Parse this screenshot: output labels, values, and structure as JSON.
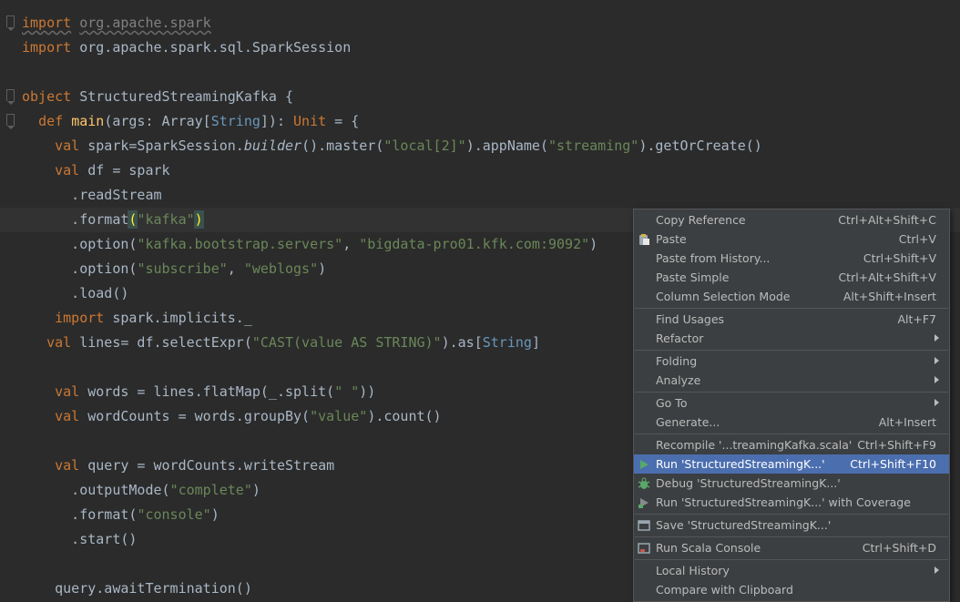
{
  "editor": {
    "lines": [
      {
        "parts": [
          {
            "t": "import",
            "c": "kw und"
          },
          {
            "t": " "
          },
          {
            "t": "org.apache.spark",
            "c": "gray und"
          }
        ]
      },
      {
        "parts": [
          {
            "t": "import",
            "c": "kw"
          },
          {
            "t": " org.apache.spark.sql.SparkSession"
          }
        ]
      },
      {
        "parts": []
      },
      {
        "parts": [
          {
            "t": "object",
            "c": "kw"
          },
          {
            "t": " StructuredStreamingKafka {"
          }
        ]
      },
      {
        "parts": [
          {
            "t": "  "
          },
          {
            "t": "def",
            "c": "kw"
          },
          {
            "t": " "
          },
          {
            "t": "main",
            "c": "fn"
          },
          {
            "t": "(args: Array["
          },
          {
            "t": "String",
            "c": "ty"
          },
          {
            "t": "]): "
          },
          {
            "t": "Unit",
            "c": "kw"
          },
          {
            "t": " = {"
          }
        ]
      },
      {
        "parts": [
          {
            "t": "    "
          },
          {
            "t": "val",
            "c": "kw"
          },
          {
            "t": " spark=SparkSession."
          },
          {
            "t": "builder",
            "c": "it"
          },
          {
            "t": "().master("
          },
          {
            "t": "\"local[2]\"",
            "c": "str"
          },
          {
            "t": ").appName("
          },
          {
            "t": "\"streaming\"",
            "c": "str"
          },
          {
            "t": ").getOrCreate()"
          }
        ]
      },
      {
        "parts": [
          {
            "t": "    "
          },
          {
            "t": "val",
            "c": "kw"
          },
          {
            "t": " df = spark"
          }
        ]
      },
      {
        "parts": [
          {
            "t": "      .readStream"
          }
        ]
      },
      {
        "parts": [
          {
            "t": "      .format"
          },
          {
            "t": "(",
            "c": "brace y"
          },
          {
            "t": "\"kafka\"",
            "c": "str"
          },
          {
            "t": ")",
            "c": "brace y"
          }
        ],
        "hl": true
      },
      {
        "parts": [
          {
            "t": "      .option("
          },
          {
            "t": "\"kafka.bootstrap.servers\"",
            "c": "str"
          },
          {
            "t": ", "
          },
          {
            "t": "\"bigdata-pro01.kfk.com:9092\"",
            "c": "str"
          },
          {
            "t": ")"
          }
        ]
      },
      {
        "parts": [
          {
            "t": "      .option("
          },
          {
            "t": "\"subscribe\"",
            "c": "str"
          },
          {
            "t": ", "
          },
          {
            "t": "\"weblogs\"",
            "c": "str"
          },
          {
            "t": ")"
          }
        ]
      },
      {
        "parts": [
          {
            "t": "      .load()"
          }
        ]
      },
      {
        "parts": [
          {
            "t": "    "
          },
          {
            "t": "import",
            "c": "kw"
          },
          {
            "t": " spark.implicits._"
          }
        ]
      },
      {
        "parts": [
          {
            "t": "   "
          },
          {
            "t": "val",
            "c": "kw"
          },
          {
            "t": " lines= df.selectExpr("
          },
          {
            "t": "\"CAST(value AS STRING)\"",
            "c": "str"
          },
          {
            "t": ").as["
          },
          {
            "t": "String",
            "c": "ty"
          },
          {
            "t": "]"
          }
        ]
      },
      {
        "parts": []
      },
      {
        "parts": [
          {
            "t": "    "
          },
          {
            "t": "val",
            "c": "kw"
          },
          {
            "t": " words = lines.flatMap(_.split("
          },
          {
            "t": "\" \"",
            "c": "str"
          },
          {
            "t": "))"
          }
        ]
      },
      {
        "parts": [
          {
            "t": "    "
          },
          {
            "t": "val",
            "c": "kw"
          },
          {
            "t": " wordCounts = words.groupBy("
          },
          {
            "t": "\"value\"",
            "c": "str"
          },
          {
            "t": ").count()"
          }
        ]
      },
      {
        "parts": []
      },
      {
        "parts": [
          {
            "t": "    "
          },
          {
            "t": "val",
            "c": "kw"
          },
          {
            "t": " query = wordCounts.writeStream"
          }
        ]
      },
      {
        "parts": [
          {
            "t": "      .outputMode("
          },
          {
            "t": "\"complete\"",
            "c": "str"
          },
          {
            "t": ")"
          }
        ]
      },
      {
        "parts": [
          {
            "t": "      .format("
          },
          {
            "t": "\"console\"",
            "c": "str"
          },
          {
            "t": ")"
          }
        ]
      },
      {
        "parts": [
          {
            "t": "      .start()"
          }
        ]
      },
      {
        "parts": []
      },
      {
        "parts": [
          {
            "t": "    query.awaitTermination()"
          }
        ]
      }
    ]
  },
  "context_menu": {
    "items": [
      {
        "label": "Copy Reference",
        "shortcut": "Ctrl+Alt+Shift+C"
      },
      {
        "label": "Paste",
        "shortcut": "Ctrl+V",
        "icon": "paste-icon"
      },
      {
        "label": "Paste from History...",
        "shortcut": "Ctrl+Shift+V"
      },
      {
        "label": "Paste Simple",
        "shortcut": "Ctrl+Alt+Shift+V"
      },
      {
        "label": "Column Selection Mode",
        "shortcut": "Alt+Shift+Insert"
      },
      {
        "sep": true
      },
      {
        "label": "Find Usages",
        "shortcut": "Alt+F7"
      },
      {
        "label": "Refactor",
        "submenu": true
      },
      {
        "sep": true
      },
      {
        "label": "Folding",
        "submenu": true
      },
      {
        "label": "Analyze",
        "submenu": true
      },
      {
        "sep": true
      },
      {
        "label": "Go To",
        "submenu": true
      },
      {
        "label": "Generate...",
        "shortcut": "Alt+Insert"
      },
      {
        "sep": true
      },
      {
        "label": "Recompile '...treamingKafka.scala'",
        "shortcut": "Ctrl+Shift+F9"
      },
      {
        "label": "Run 'StructuredStreamingK...'",
        "shortcut": "Ctrl+Shift+F10",
        "icon": "run-icon",
        "selected": true
      },
      {
        "label": "Debug 'StructuredStreamingK...'",
        "icon": "debug-icon"
      },
      {
        "label": "Run 'StructuredStreamingK...' with Coverage",
        "icon": "coverage-icon"
      },
      {
        "sep": true
      },
      {
        "label": "Save 'StructuredStreamingK...'",
        "icon": "save-config-icon"
      },
      {
        "sep": true
      },
      {
        "label": "Run Scala Console",
        "shortcut": "Ctrl+Shift+D",
        "icon": "console-icon"
      },
      {
        "sep": true
      },
      {
        "label": "Local History",
        "submenu": true
      },
      {
        "label": "Compare with Clipboard"
      }
    ]
  },
  "colors": {
    "background": "#2b2b2b",
    "keyword": "#cc7832",
    "string": "#6a8759",
    "function": "#ffc66d",
    "type": "#6897bb",
    "menu_bg": "#3c3f41",
    "menu_selected": "#4b6eaf"
  }
}
